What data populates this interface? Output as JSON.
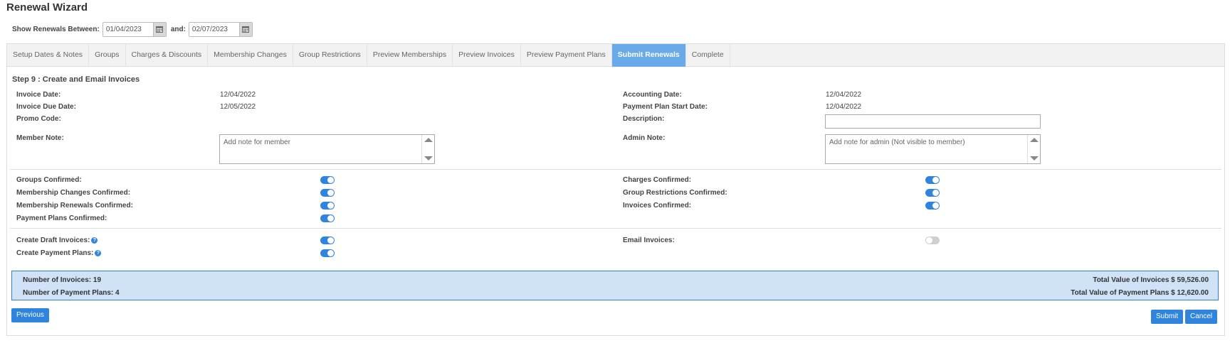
{
  "page_title": "Renewal Wizard",
  "date_range": {
    "label": "Show Renewals Between:",
    "from": "01/04/2023",
    "and_label": "and:",
    "to": "02/07/2023"
  },
  "tabs": [
    {
      "label": "Setup Dates & Notes",
      "active": false
    },
    {
      "label": "Groups",
      "active": false
    },
    {
      "label": "Charges & Discounts",
      "active": false
    },
    {
      "label": "Membership Changes",
      "active": false
    },
    {
      "label": "Group Restrictions",
      "active": false
    },
    {
      "label": "Preview Memberships",
      "active": false
    },
    {
      "label": "Preview Invoices",
      "active": false
    },
    {
      "label": "Preview Payment Plans",
      "active": false
    },
    {
      "label": "Submit Renewals",
      "active": true
    },
    {
      "label": "Complete",
      "active": false
    }
  ],
  "step_title": "Step 9 : Create and Email Invoices",
  "fields": {
    "invoice_date": {
      "label": "Invoice Date:",
      "value": "12/04/2022"
    },
    "invoice_due_date": {
      "label": "Invoice Due Date:",
      "value": "12/05/2022"
    },
    "promo_code": {
      "label": "Promo Code:",
      "value": ""
    },
    "member_note": {
      "label": "Member Note:",
      "placeholder": "Add note for member"
    },
    "accounting_date": {
      "label": "Accounting Date:",
      "value": "12/04/2022"
    },
    "payment_plan_start_date": {
      "label": "Payment Plan Start Date:",
      "value": "12/04/2022"
    },
    "description": {
      "label": "Description:",
      "value": ""
    },
    "admin_note": {
      "label": "Admin Note:",
      "placeholder": "Add note for admin (Not visible to member)"
    }
  },
  "confirmations": {
    "groups": {
      "label": "Groups Confirmed:",
      "on": true
    },
    "membership_changes": {
      "label": "Membership Changes Confirmed:",
      "on": true
    },
    "membership_renewals": {
      "label": "Membership Renewals Confirmed:",
      "on": true
    },
    "payment_plans": {
      "label": "Payment Plans Confirmed:",
      "on": true
    },
    "charges": {
      "label": "Charges Confirmed:",
      "on": true
    },
    "group_restrictions": {
      "label": "Group Restrictions Confirmed:",
      "on": true
    },
    "invoices": {
      "label": "Invoices Confirmed:",
      "on": true
    }
  },
  "options": {
    "create_draft_invoices": {
      "label": "Create Draft Invoices:",
      "on": true
    },
    "create_payment_plans": {
      "label": "Create Payment Plans:",
      "on": true
    },
    "email_invoices": {
      "label": "Email Invoices:",
      "on": false
    }
  },
  "summary": {
    "num_invoices": "Number of Invoices: 19",
    "num_payment_plans": "Number of Payment Plans: 4",
    "total_invoices": "Total Value of Invoices $ 59,526.00",
    "total_payment_plans": "Total Value of Payment Plans $ 12,620.00"
  },
  "buttons": {
    "previous": "Previous",
    "submit": "Submit",
    "cancel": "Cancel"
  },
  "colors": {
    "accent": "#2f84dd",
    "active_tab": "#6aaae8",
    "summary_bg": "#cfe2f6"
  }
}
